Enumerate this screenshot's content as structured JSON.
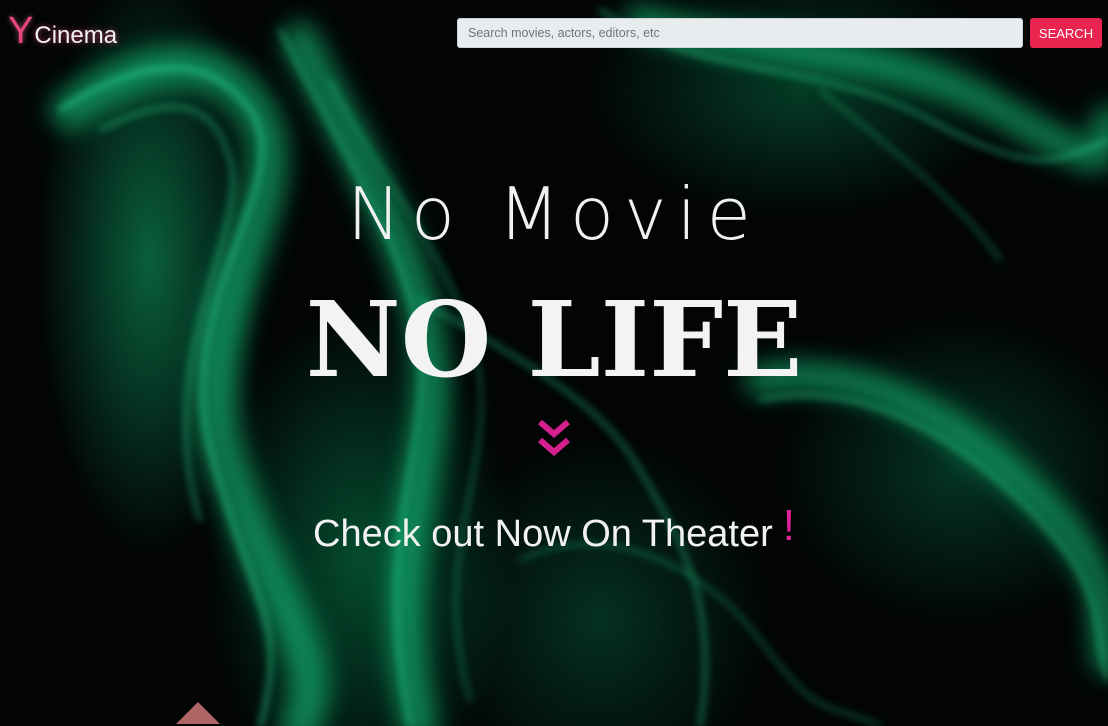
{
  "header": {
    "logo_letter": "Y",
    "logo_word": "Cinema",
    "search": {
      "placeholder": "Search movies, actors, editors, etc",
      "value": ""
    },
    "search_button_label": "SEARCH"
  },
  "hero": {
    "title_small": "No Movie",
    "title_big": "NO LIFE",
    "tagline": "Check out Now On Theater",
    "tagline_mark": "!"
  },
  "icons": {
    "scroll_down": "chevrons-down-icon",
    "back_to_top": "up-arrow-icon"
  },
  "colors": {
    "accent_pink": "#e8457a",
    "search_button": "#e8244f",
    "chevron_magenta": "#d61f8f",
    "smoke_green": "#10c27a"
  }
}
